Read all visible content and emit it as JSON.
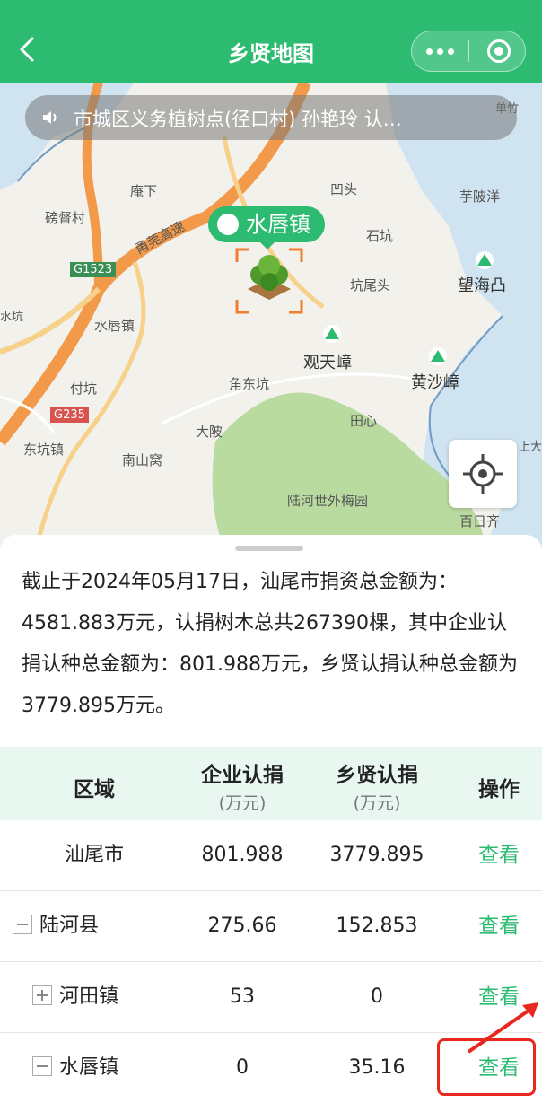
{
  "header": {
    "title": "乡贤地图"
  },
  "map": {
    "notice": "市城区义务植树点(径口村) 孙艳玲 认…",
    "pin_label": "水唇镇",
    "labels": {
      "l1": "磅督村",
      "l2": "庵下",
      "l3": "凹头",
      "l4": "芋陂洋",
      "l5": "石坑",
      "l6": "G1523",
      "l7": "甬莞高速",
      "l8": "坑尾头",
      "l9": "望海凸",
      "l10": "水唇镇",
      "l11": "观天嶂",
      "l12": "角东坑",
      "l13": "黄沙嶂",
      "l14": "付坑",
      "l15": "田心",
      "l16": "G235",
      "l17": "大陂",
      "l18": "东坑镇",
      "l19": "南山窝",
      "l20": "陆河世外梅园",
      "l21": "百日齐",
      "l22": "单竹",
      "l23": "水坑",
      "l24": "上大"
    }
  },
  "summary": "截止于2024年05月17日，汕尾市捐资总金额为：4581.883万元，认捐树木总共267390棵，其中企业认捐认种总金额为：801.988万元，乡贤认捐认种总金额为3779.895万元。",
  "table": {
    "headers": {
      "area": "区域",
      "enterprise": "企业认捐",
      "enterprise_unit": "(万元)",
      "xiangxian": "乡贤认捐",
      "xiangxian_unit": "(万元)",
      "action": "操作"
    },
    "rows": [
      {
        "area": "汕尾市",
        "enterprise": "801.988",
        "xiangxian": "3779.895",
        "action": "查看"
      },
      {
        "area": "陆河县",
        "enterprise": "275.66",
        "xiangxian": "152.853",
        "action": "查看"
      },
      {
        "area": "河田镇",
        "enterprise": "53",
        "xiangxian": "0",
        "action": "查看"
      },
      {
        "area": "水唇镇",
        "enterprise": "0",
        "xiangxian": "35.16",
        "action": "查看"
      }
    ]
  },
  "colors": {
    "brand": "#2dbb72",
    "highlight": "#e8281e"
  }
}
